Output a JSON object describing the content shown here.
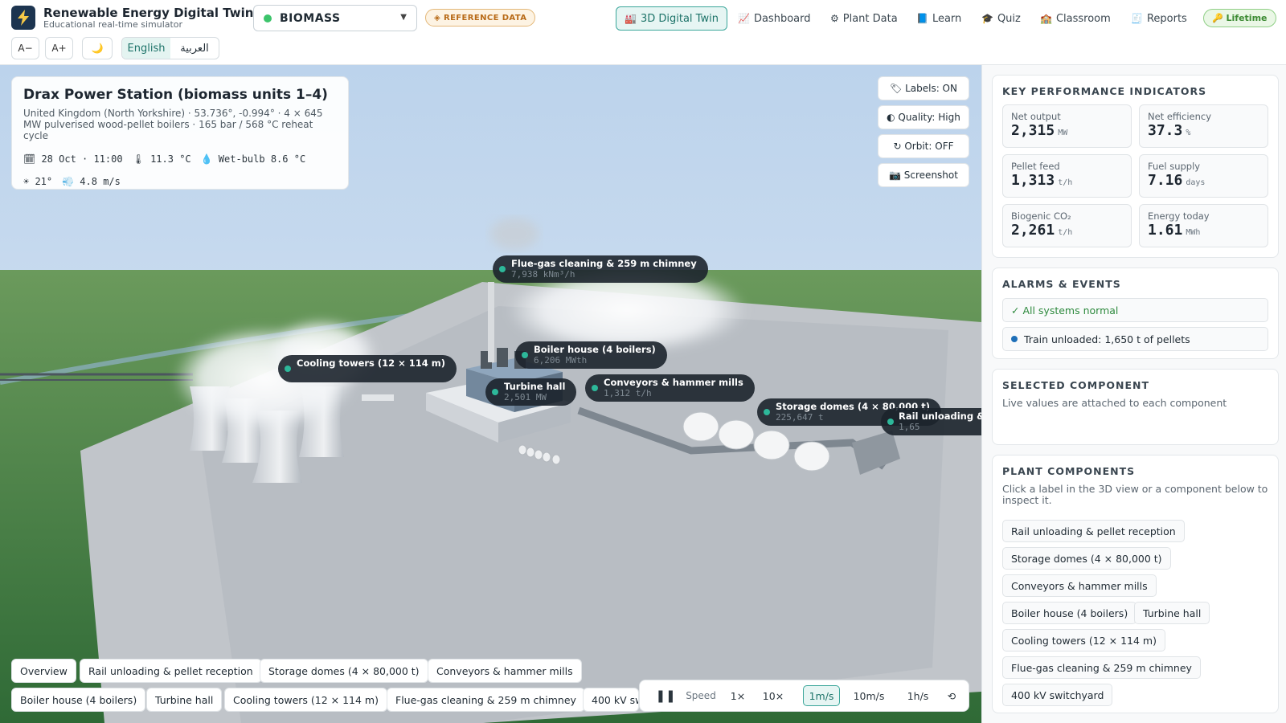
{
  "app": {
    "title": "Renewable Energy Digital Twin",
    "subtitle": "Educational real-time simulator",
    "logo_icon": "lightning-bolt-icon"
  },
  "source_select": {
    "value": "BIOMASS",
    "status_color": "#3cc46b"
  },
  "reference_badge": "◈ REFERENCE DATA",
  "nav": [
    {
      "icon": "🏭",
      "label": "3D Digital Twin",
      "active": true
    },
    {
      "icon": "📈",
      "label": "Dashboard"
    },
    {
      "icon": "⚙",
      "label": "Plant Data"
    },
    {
      "icon": "📘",
      "label": "Learn"
    },
    {
      "icon": "🎓",
      "label": "Quiz"
    },
    {
      "icon": "🏫",
      "label": "Classroom"
    },
    {
      "icon": "🧾",
      "label": "Reports"
    }
  ],
  "license_badge": "🔑 Lifetime",
  "font_controls": {
    "decrease": "A−",
    "increase": "A+",
    "theme": "🌙"
  },
  "language": {
    "english": "English",
    "arabic": "العربية"
  },
  "site": {
    "name": "Drax Power Station (biomass units 1–4)",
    "description": "United Kingdom (North Yorkshire) · 53.736°, -0.994° · 4 × 645 MW pulverised wood-pellet boilers · 165 bar / 568 °C reheat cycle",
    "date": "🗓 28 Oct · 11:00",
    "temperature": "🌡 11.3 °C",
    "wet_bulb": "💧 Wet-bulb 8.6 °C",
    "sun": "☀ 21°",
    "wind": "💨 4.8 m/s"
  },
  "view_controls": {
    "labels": "🏷 Labels: ON",
    "quality": "◐ Quality: High",
    "orbit": "↻ Orbit: OFF",
    "screenshot": "📷 Screenshot"
  },
  "scene_labels": [
    {
      "name": "Flue-gas cleaning & 259 m chimney",
      "value": "7,938 kNm³/h"
    },
    {
      "name": "Boiler house (4 boilers)",
      "value": "6,206 MWth"
    },
    {
      "name": "Cooling towers (12 × 114 m)",
      "value": ""
    },
    {
      "name": "Turbine hall",
      "value": "2,501 MW"
    },
    {
      "name": "Conveyors & hammer mills",
      "value": "1,312 t/h"
    },
    {
      "name": "Storage domes (4 × 80,000 t)",
      "value": "225,647 t"
    },
    {
      "name": "Rail unloading &",
      "value": "1,65"
    }
  ],
  "bottom_chips": [
    "Overview",
    "Rail unloading & pellet reception",
    "Storage domes (4 × 80,000 t)",
    "Conveyors & hammer mills",
    "Boiler house (4 boilers)",
    "Turbine hall",
    "Cooling towers (12 × 114 m)",
    "Flue-gas cleaning & 259 m chimney",
    "400 kV sw"
  ],
  "speed": {
    "pause": "❚❚",
    "label": "Speed",
    "options": [
      "1×",
      "10×",
      "1m/s",
      "10m/s",
      "1h/s"
    ],
    "selected": "1m/s",
    "reset": "⟲"
  },
  "kpi": {
    "title": "KEY PERFORMANCE INDICATORS",
    "items": [
      {
        "label": "Net output",
        "value": "2,315",
        "unit": "MW"
      },
      {
        "label": "Net efficiency",
        "value": "37.3",
        "unit": "%"
      },
      {
        "label": "Pellet feed",
        "value": "1,313",
        "unit": "t/h"
      },
      {
        "label": "Fuel supply",
        "value": "7.16",
        "unit": "days"
      },
      {
        "label": "Biogenic CO₂",
        "value": "2,261",
        "unit": "t/h"
      },
      {
        "label": "Energy today",
        "value": "1.61",
        "unit": "MWh"
      }
    ]
  },
  "alarms": {
    "title": "ALARMS & EVENTS",
    "normal": "✓ All systems normal",
    "event": "Train unloaded: 1,650 t of pellets"
  },
  "selected": {
    "title": "SELECTED COMPONENT",
    "text": "Live values are attached to each component"
  },
  "components": {
    "title": "PLANT COMPONENTS",
    "hint": "Click a label in the 3D view or a component below to inspect it.",
    "items": [
      "Rail unloading & pellet reception",
      "Storage domes (4 × 80,000 t)",
      "Conveyors & hammer mills",
      "Boiler house (4 boilers)",
      "Turbine hall",
      "Cooling towers (12 × 114 m)",
      "Flue-gas cleaning & 259 m chimney",
      "400 kV switchyard"
    ]
  }
}
